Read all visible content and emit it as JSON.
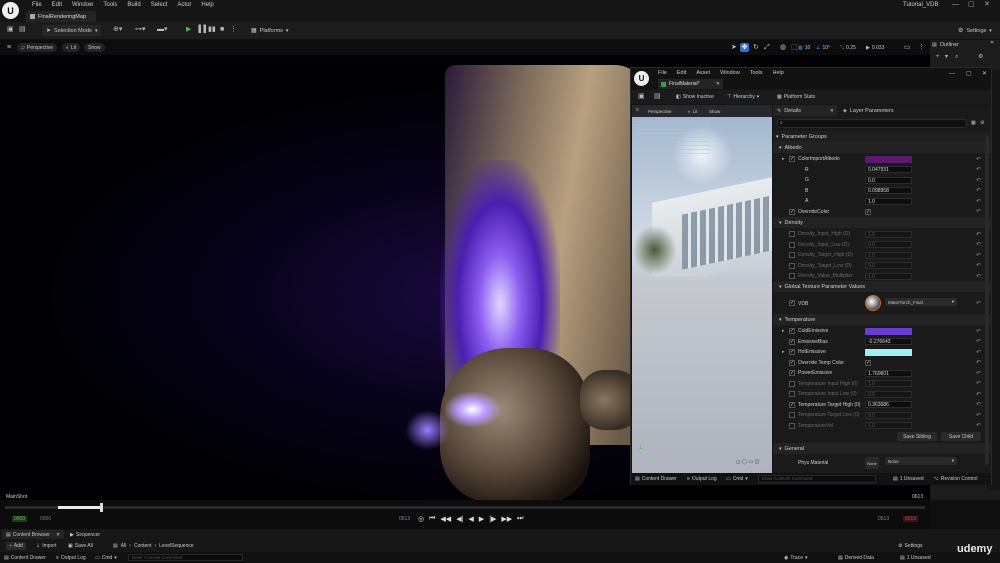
{
  "menu": [
    "File",
    "Edit",
    "Window",
    "Tools",
    "Build",
    "Select",
    "Actor",
    "Help"
  ],
  "project_name": "Tutorial_VDB",
  "map_tab": "FinalRenderingMap",
  "toolbar": {
    "selection_mode": "Selection Mode",
    "platforms": "Platforms",
    "settings": "Settings"
  },
  "viewport": {
    "perspective": "Perspective",
    "lit": "Lit",
    "show": "Show",
    "grid_snap": "10",
    "rot_snap": "10°",
    "scale_snap": "0.25",
    "cam_speed": "0.033",
    "sequence_name": "MainShot",
    "frame_end": "0613"
  },
  "outliner_title": "Outliner",
  "mat_window": {
    "menu": [
      "File",
      "Edit",
      "Asset",
      "Window",
      "Tools",
      "Help"
    ],
    "tab": "FinalMaterial*",
    "show_inactive": "Show Inactive",
    "hierarchy": "Hierarchy",
    "platform_stats": "Platform Stats",
    "preview": {
      "perspective": "Perspective",
      "lit": "Lit",
      "show": "Show"
    },
    "details_tab": "Details",
    "layer_tab": "Layer Parameters",
    "groups_label": "Parameter Groups",
    "albedo": {
      "title": "Albedo",
      "params": [
        {
          "name": "ColorImportAlbedo",
          "value": "",
          "on": true,
          "color": "#5c1a6e"
        },
        {
          "name": "R",
          "value": "0.047931",
          "on": false,
          "color": ""
        },
        {
          "name": "G",
          "value": "0.0",
          "on": false,
          "color": ""
        },
        {
          "name": "B",
          "value": "0.098958",
          "on": false,
          "color": ""
        },
        {
          "name": "A",
          "value": "1.0",
          "on": false,
          "color": ""
        },
        {
          "name": "OverrideColor",
          "value": "✓",
          "on": true,
          "color": ""
        }
      ]
    },
    "density": {
      "title": "Density",
      "params": [
        {
          "name": "Density_Input_High (D)",
          "value": "1.0"
        },
        {
          "name": "Density_Input_Low (D)",
          "value": "0.0"
        },
        {
          "name": "Density_Target_High (D)",
          "value": "1.0"
        },
        {
          "name": "Density_Target_Low (D)",
          "value": "0.0"
        },
        {
          "name": "Density_Value_Multiplier",
          "value": "1.0"
        }
      ]
    },
    "global_tex": {
      "title": "Global Texture Parameter Values",
      "param": "VDB",
      "asset": "MaterTorch_Final"
    },
    "temperature": {
      "title": "Temperature",
      "params": [
        {
          "name": "ColdEmissive",
          "value": "",
          "on": true,
          "color": "#6a3fcf",
          "dim": false
        },
        {
          "name": "EmissiveBias",
          "value": "-0.276643",
          "on": true,
          "color": "",
          "dim": false
        },
        {
          "name": "HotEmissive",
          "value": "",
          "on": true,
          "color": "#9ef0f3",
          "dim": false
        },
        {
          "name": "Override Temp Color",
          "value": "✓",
          "on": true,
          "color": "",
          "dim": false
        },
        {
          "name": "PowerEmissive",
          "value": "1.760601",
          "on": true,
          "color": "",
          "dim": false
        },
        {
          "name": "Temperature Input High (0)",
          "value": "1.0",
          "on": false,
          "color": "",
          "dim": true
        },
        {
          "name": "Temperature Input Low (0)",
          "value": "0.0",
          "on": false,
          "color": "",
          "dim": true
        },
        {
          "name": "Temperature Target High (0)",
          "value": "0.363686",
          "on": true,
          "color": "",
          "dim": false
        },
        {
          "name": "Temperature Target Low (0)",
          "value": "0.0",
          "on": false,
          "color": "",
          "dim": true
        },
        {
          "name": "TemperatureVol",
          "value": "1.0",
          "on": false,
          "color": "",
          "dim": true
        }
      ]
    },
    "save_sibling": "Save Sibling",
    "save_child": "Save Child",
    "general": {
      "title": "General",
      "phys_label": "Phys Material",
      "phys_value": "None",
      "phys_none": "None"
    },
    "content_drawer": "Content Drawer",
    "output_log": "Output Log",
    "cmd": "Cmd",
    "console_placeholder": "Enter Console Command",
    "unsaved": "1 Unsaved",
    "revision": "Revision Control"
  },
  "bottom": {
    "content_browser": "Content Browser",
    "sequencer": "Sequencer",
    "add": "Add",
    "import": "Import",
    "save_all": "Save All",
    "path": [
      "All",
      "Content",
      "LevelSequence"
    ],
    "settings": "Settings",
    "status": {
      "content_drawer": "Content Drawer",
      "output_log": "Output Log",
      "cmd": "Cmd",
      "console": "Enter Console Command",
      "trace": "Trace",
      "derived": "Derived Data",
      "unsaved": "1 Unsaved",
      "revision": "Revision Control"
    },
    "watermark": "udemy"
  },
  "seq": {
    "start": "0000",
    "mid": "0000",
    "cur": "0613",
    "end": "0613"
  }
}
